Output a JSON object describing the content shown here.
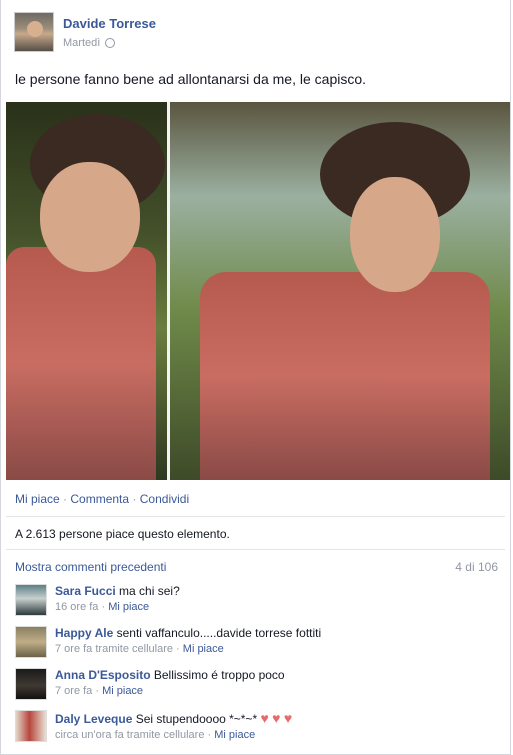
{
  "post": {
    "author": "Davide Torrese",
    "time": "Martedì",
    "status": "le persone fanno bene ad allontanarsi da me, le capisco.",
    "actions": [
      "Mi piace",
      "Commenta",
      "Condividi"
    ],
    "likes_text": "A 2.613 persone piace questo elemento.",
    "prev_comments": "Mostra commenti precedenti",
    "comment_count": "4 di 106"
  },
  "icons": {
    "privacy": "globe-icon",
    "avatar": "profile-photo",
    "heart": "heart-emoji"
  },
  "comments": [
    {
      "name": "Sara Fucci",
      "text": "ma chi sei?",
      "meta": "16 ore fa",
      "like": "Mi piace"
    },
    {
      "name": "Happy Ale",
      "text": "senti vaffanculo.....davide torrese fottiti",
      "meta": "7 ore fa tramite cellulare",
      "like": "Mi piace"
    },
    {
      "name": "Anna D'Esposito",
      "text": "Bellissimo é troppo poco",
      "meta": "7 ore fa",
      "like": "Mi piace"
    },
    {
      "name": "Daly Leveque",
      "text": "Sei stupendoooo *~*~*",
      "meta": "circa un'ora fa tramite cellulare",
      "like": "Mi piace"
    }
  ]
}
